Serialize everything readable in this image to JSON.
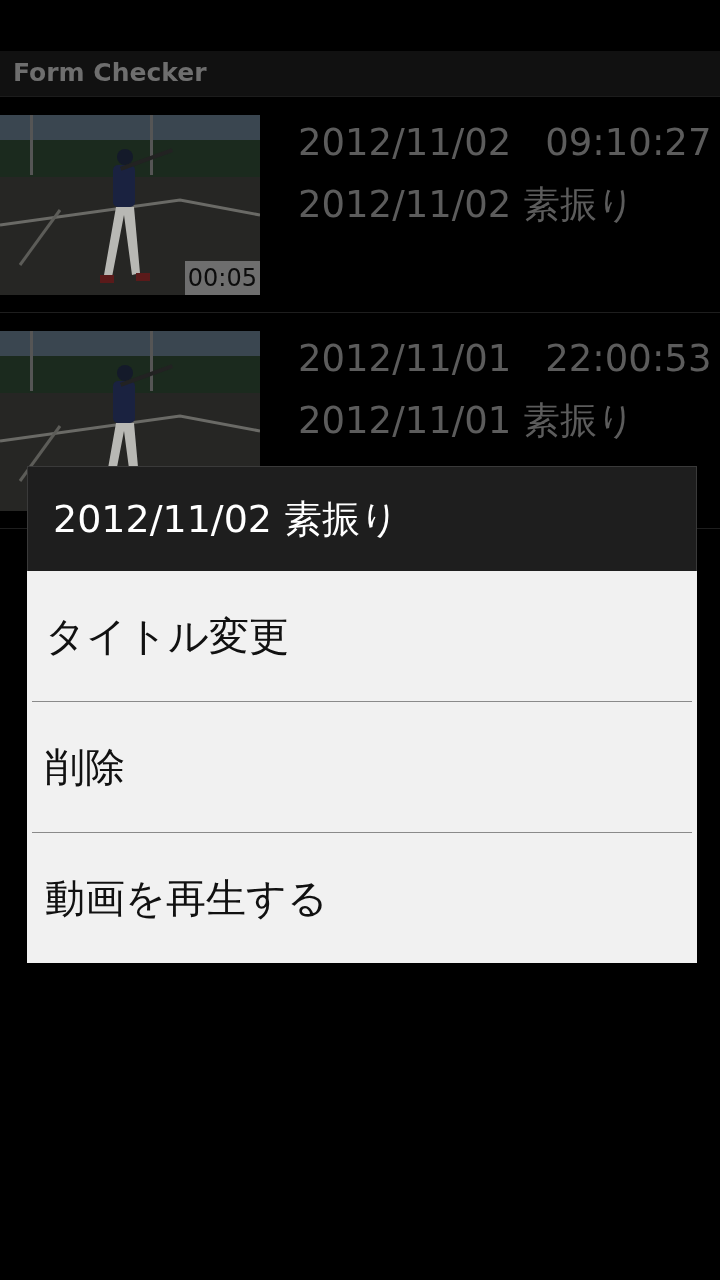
{
  "app_bar": {
    "title": "Form Checker"
  },
  "videos": [
    {
      "date": "2012/11/02",
      "time": "09:10:27",
      "title": "2012/11/02 素振り",
      "duration": "00:05"
    },
    {
      "date": "2012/11/01",
      "time": "22:00:53",
      "title": "2012/11/01 素振り"
    }
  ],
  "dialog": {
    "title": "2012/11/02 素振り",
    "items": [
      "タイトル変更",
      "削除",
      "動画を再生する"
    ]
  }
}
